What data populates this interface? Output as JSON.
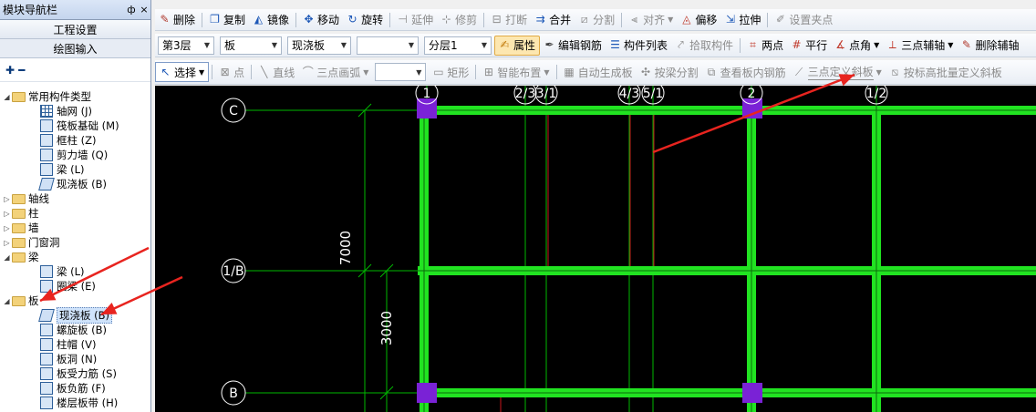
{
  "nav": {
    "title": "模块导航栏",
    "pin_glyph": "ф",
    "close_glyph": "×",
    "sections": [
      "工程设置",
      "绘图输入"
    ],
    "tools": [
      "✚",
      "━"
    ],
    "tree": [
      {
        "label": "常用构件类型",
        "level": 0,
        "type": "folder",
        "expanded": true
      },
      {
        "label": "轴网 (J)",
        "level": 1,
        "type": "grid"
      },
      {
        "label": "筏板基础 (M)",
        "level": 1,
        "type": "item"
      },
      {
        "label": "框柱 (Z)",
        "level": 1,
        "type": "item"
      },
      {
        "label": "剪力墙 (Q)",
        "level": 1,
        "type": "item"
      },
      {
        "label": "梁 (L)",
        "level": 1,
        "type": "item"
      },
      {
        "label": "现浇板 (B)",
        "level": 1,
        "type": "slab"
      },
      {
        "label": "轴线",
        "level": 0,
        "type": "folder",
        "expanded": false
      },
      {
        "label": "柱",
        "level": 0,
        "type": "folder",
        "expanded": false
      },
      {
        "label": "墙",
        "level": 0,
        "type": "folder",
        "expanded": false
      },
      {
        "label": "门窗洞",
        "level": 0,
        "type": "folder",
        "expanded": false
      },
      {
        "label": "梁",
        "level": 0,
        "type": "folder",
        "expanded": true
      },
      {
        "label": "梁 (L)",
        "level": 1,
        "type": "item"
      },
      {
        "label": "圈梁 (E)",
        "level": 1,
        "type": "item"
      },
      {
        "label": "板",
        "level": 0,
        "type": "folder",
        "expanded": true
      },
      {
        "label": "现浇板 (B)",
        "level": 1,
        "type": "slab",
        "selected": true
      },
      {
        "label": "螺旋板 (B)",
        "level": 1,
        "type": "item"
      },
      {
        "label": "柱帽 (V)",
        "level": 1,
        "type": "item"
      },
      {
        "label": "板洞 (N)",
        "level": 1,
        "type": "item"
      },
      {
        "label": "板受力筋 (S)",
        "level": 1,
        "type": "item"
      },
      {
        "label": "板负筋 (F)",
        "level": 1,
        "type": "item"
      },
      {
        "label": "楼层板带 (H)",
        "level": 1,
        "type": "item"
      }
    ]
  },
  "toolbar1": {
    "delete": "删除",
    "copy": "复制",
    "mirror": "镜像",
    "move": "移动",
    "rotate": "旋转",
    "extend": "延伸",
    "trim": "修剪",
    "break": "打断",
    "merge": "合并",
    "split": "分割",
    "align": "对齐",
    "offset": "偏移",
    "stretch": "拉伸",
    "set_grip": "设置夹点"
  },
  "toolbar2": {
    "floor": "第3层",
    "category": "板",
    "type": "现浇板",
    "component": "",
    "sublayer": "分层1",
    "property": "属性",
    "edit_rebar": "编辑钢筋",
    "component_list": "构件列表",
    "pick_component": "拾取构件",
    "two_points": "两点",
    "parallel": "平行",
    "point_angle": "点角",
    "three_point_axis": "三点辅轴",
    "delete_axis": "删除辅轴"
  },
  "toolbar3": {
    "select": "选择",
    "point": "点",
    "line": "直线",
    "arc": "三点画弧",
    "arc_combo": "",
    "rect": "矩形",
    "smart_layout": "智能布置",
    "auto_slab": "自动生成板",
    "split_by_beam": "按梁分割",
    "view_rebar": "查看板内钢筋",
    "three_point_slope": "三点定义斜板",
    "batch_slope": "按标高批量定义斜板"
  },
  "canvas": {
    "axis_labels": [
      "1",
      "2/3",
      "3/1",
      "4/3",
      "5/1",
      "2",
      "1/2",
      "C",
      "1/B",
      "B"
    ],
    "dims": [
      "7000",
      "3000"
    ],
    "colors": {
      "beam": "#21e321",
      "column": "#7a22d6",
      "axis": "#00b800",
      "red_line": "#c8161b",
      "arrow": "#e8241f"
    }
  }
}
